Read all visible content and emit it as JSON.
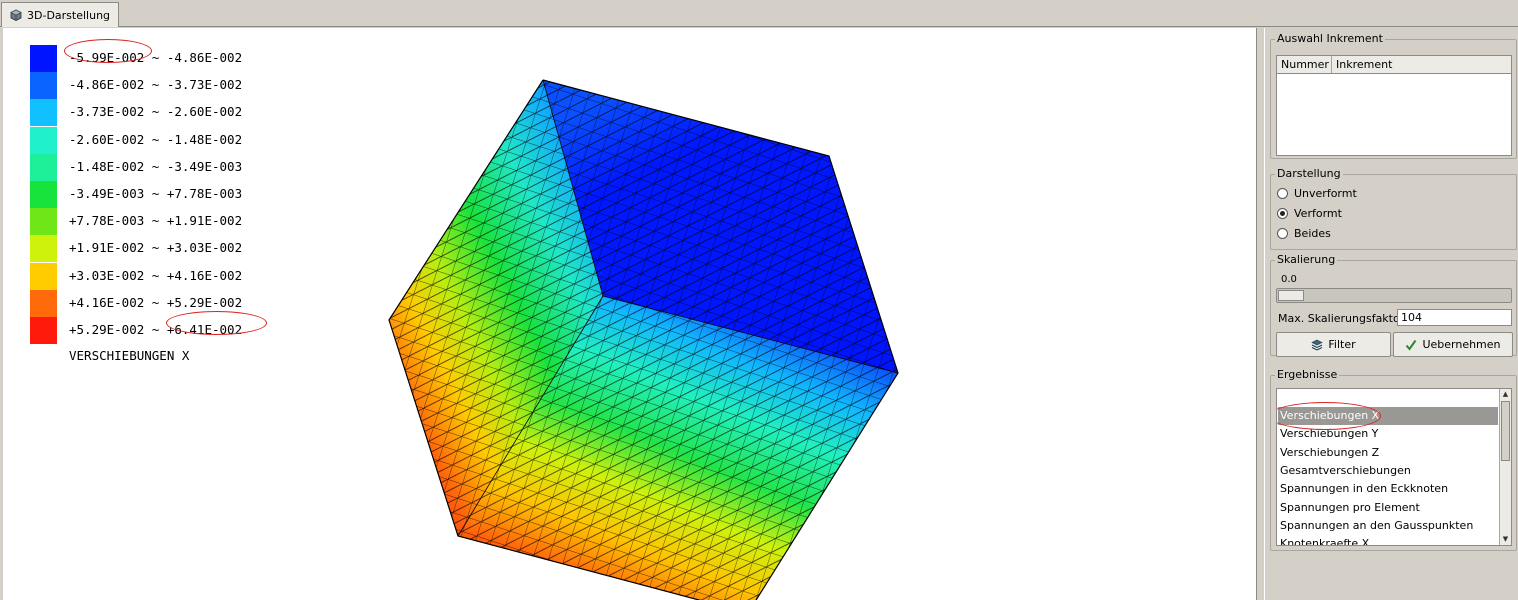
{
  "tab": {
    "label": "3D-Darstellung",
    "icon": "cube-icon"
  },
  "legend": {
    "rows": [
      {
        "color": "#0014ff",
        "range": "-5.99E-002 ~ -4.86E-002"
      },
      {
        "color": "#0a64ff",
        "range": "-4.86E-002 ~ -3.73E-002"
      },
      {
        "color": "#10c0ff",
        "range": "-3.73E-002 ~ -2.60E-002"
      },
      {
        "color": "#20f0cc",
        "range": "-2.60E-002 ~ -1.48E-002"
      },
      {
        "color": "#1ef09a",
        "range": "-1.48E-002 ~ -3.49E-003"
      },
      {
        "color": "#18e23c",
        "range": "-3.49E-003 ~ +7.78E-003"
      },
      {
        "color": "#6ee618",
        "range": "+7.78E-003 ~ +1.91E-002"
      },
      {
        "color": "#cef20c",
        "range": "+1.91E-002 ~ +3.03E-002"
      },
      {
        "color": "#ffcc00",
        "range": "+3.03E-002 ~ +4.16E-002"
      },
      {
        "color": "#ff6a0a",
        "range": "+4.16E-002 ~ +5.29E-002"
      },
      {
        "color": "#ff1a0c",
        "range": "+5.29E-002 ~ +6.41E-002"
      }
    ],
    "title": "VERSCHIEBUNGEN X"
  },
  "panel": {
    "increment": {
      "title": "Auswahl Inkrement",
      "columns": [
        "Nummer",
        "Inkrement"
      ]
    },
    "display": {
      "title": "Darstellung",
      "options": [
        "Unverformt",
        "Verformt",
        "Beides"
      ],
      "selected": "Verformt"
    },
    "scaling": {
      "title": "Skalierung",
      "slider_value": "0.0",
      "factor_label": "Max. Skalierungsfaktor",
      "factor_value": "104",
      "filter_label": "Filter",
      "apply_label": "Uebernehmen"
    },
    "results": {
      "title": "Ergebnisse",
      "items": [
        "Verschiebungen X",
        "Verschiebungen Y",
        "Verschiebungen Z",
        "Gesamtverschiebungen",
        "Spannungen in den Eckknoten",
        "Spannungen pro Element",
        "Spannungen an den Gausspunkten",
        "Knotenkraefte X"
      ],
      "selected": "Verschiebungen X"
    }
  }
}
